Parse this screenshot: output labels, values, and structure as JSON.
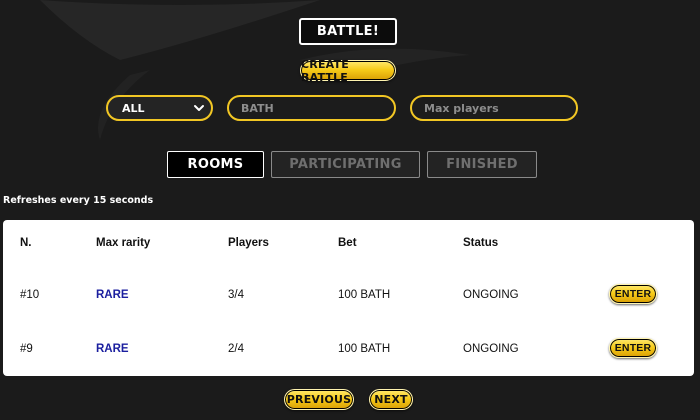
{
  "header": {
    "title": "BATTLE!",
    "create_label": "CREATE BATTLE"
  },
  "filters": {
    "rarity_selected": "ALL",
    "bath_placeholder": "BATH",
    "max_players_placeholder": "Max players"
  },
  "tabs": [
    {
      "label": "ROOMS",
      "active": true
    },
    {
      "label": "PARTICIPATING",
      "active": false
    },
    {
      "label": "FINISHED",
      "active": false
    }
  ],
  "refresh_note": "Refreshes every 15 seconds",
  "table": {
    "columns": [
      "N.",
      "Max rarity",
      "Players",
      "Bet",
      "Status"
    ],
    "rows": [
      {
        "n": "#10",
        "rarity": "RARE",
        "players": "3/4",
        "bet": "100 BATH",
        "status": "ONGOING",
        "action": "ENTER"
      },
      {
        "n": "#9",
        "rarity": "RARE",
        "players": "2/4",
        "bet": "100 BATH",
        "status": "ONGOING",
        "action": "ENTER"
      }
    ]
  },
  "pagination": {
    "previous_label": "PREVIOUS",
    "next_label": "NEXT"
  },
  "colors": {
    "background": "#1b1b1b",
    "accent_gold": "#f2c724",
    "rarity_rare": "#1b1f9f"
  }
}
